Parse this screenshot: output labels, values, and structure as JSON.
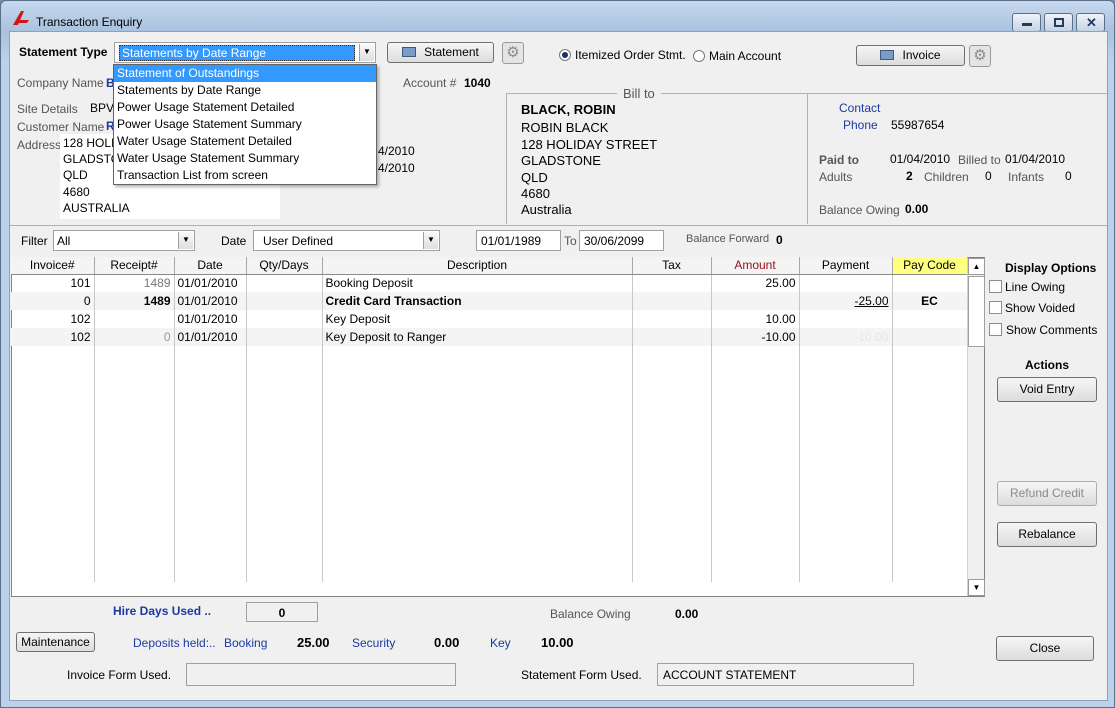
{
  "window": {
    "title": "Transaction Enquiry"
  },
  "header": {
    "statement_type_label": "Statement Type",
    "statement_type_value": "Statements by Date Range",
    "statement_button": "Statement",
    "radio_itemized": "Itemized Order Stmt.",
    "radio_main": "Main Account",
    "invoice_button": "Invoice"
  },
  "dropdown": {
    "options": [
      "Statement of Outstandings",
      "Statements by Date Range",
      "Power Usage Statement Detailed",
      "Power Usage Statement Summary",
      "Water Usage Statement Detailed",
      "Water Usage Statement Summary",
      "Transaction List from screen"
    ],
    "highlighted": "Statement of Outstandings"
  },
  "company": {
    "company_name_label": "Company Name",
    "company_name_partial": "B",
    "account_label": "Account #",
    "account_value": "1040",
    "site_details_label": "Site Details",
    "site_details_partial": "BPV",
    "customer_name_label": "Customer Name",
    "customer_name_partial": "R",
    "address_label": "Address",
    "address_lines": [
      "128 HOLI",
      "GLADSTO",
      "QLD",
      "4680",
      "AUSTRALIA"
    ],
    "date_partial_1": "4/2010",
    "date_partial_2": "4/2010"
  },
  "bill_to": {
    "heading": "Bill to",
    "name": "BLACK, ROBIN",
    "lines": [
      "ROBIN BLACK",
      "128 HOLIDAY STREET",
      "GLADSTONE",
      "QLD",
      "4680",
      "Australia"
    ]
  },
  "contact": {
    "contact_label": "Contact",
    "phone_label": "Phone",
    "phone_value": "55987654",
    "paid_to_label": "Paid to",
    "paid_to_value": "01/04/2010",
    "billed_to_label": "Billed to",
    "billed_to_value": "01/04/2010",
    "adults_label": "Adults",
    "adults_value": "2",
    "children_label": "Children",
    "children_value": "0",
    "infants_label": "Infants",
    "infants_value": "0",
    "balance_owing_label": "Balance Owing",
    "balance_owing_value": "0.00"
  },
  "filter": {
    "filter_label": "Filter",
    "filter_value": "All",
    "date_label": "Date",
    "date_value": "User Defined",
    "from_date": "01/01/1989",
    "to_label": "To",
    "to_date": "30/06/2099",
    "balance_forward_label": "Balance Forward",
    "balance_forward_value": "0"
  },
  "grid": {
    "columns": [
      "Invoice#",
      "Receipt#",
      "Date",
      "Qty/Days",
      "Description",
      "Tax",
      "Amount",
      "Payment",
      "Pay Code"
    ],
    "rows": [
      {
        "invoice": "101",
        "receipt": "1489",
        "date": "01/01/2010",
        "qty": "",
        "description": "Booking Deposit",
        "tax": "",
        "amount": "25.00",
        "payment": "",
        "paycode": ""
      },
      {
        "invoice": "0",
        "receipt": "1489",
        "date": "01/01/2010",
        "qty": "",
        "description": "Credit Card Transaction",
        "tax": "",
        "amount": "",
        "payment": "-25.00",
        "paycode": "EC"
      },
      {
        "invoice": "102",
        "receipt": "",
        "date": "01/01/2010",
        "qty": "",
        "description": "Key Deposit",
        "tax": "",
        "amount": "10.00",
        "payment": "",
        "paycode": ""
      },
      {
        "invoice": "102",
        "receipt": "0",
        "date": "01/01/2010",
        "qty": "",
        "description": "Key Deposit to Ranger",
        "tax": "",
        "amount": "-10.00",
        "payment": "-10.00",
        "paycode": ""
      }
    ]
  },
  "side": {
    "display_options_heading": "Display Options",
    "line_owing": "Line Owing",
    "show_voided": "Show Voided",
    "show_comments": "Show  Comments",
    "actions_heading": "Actions",
    "void_entry": "Void Entry",
    "refund_credit": "Refund Credit",
    "rebalance": "Rebalance",
    "close": "Close"
  },
  "footer": {
    "hire_days_label": "Hire Days Used ..",
    "hire_days_value": "0",
    "balance_owing_label": "Balance Owing",
    "balance_owing_value": "0.00",
    "maintenance_button": "Maintenance",
    "deposits_label": "Deposits held:..",
    "booking_label": "Booking",
    "booking_value": "25.00",
    "security_label": "Security",
    "security_value": "0.00",
    "key_label": "Key",
    "key_value": "10.00",
    "invoice_form_label": "Invoice Form Used.",
    "invoice_form_value": "",
    "statement_form_label": "Statement Form Used.",
    "statement_form_value": "ACCOUNT STATEMENT"
  }
}
